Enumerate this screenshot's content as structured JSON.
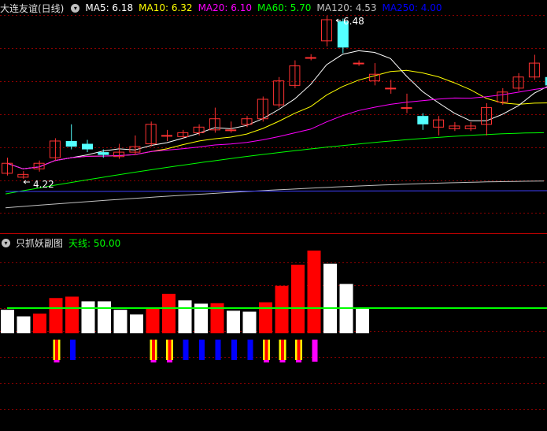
{
  "main_panel": {
    "stock_name": "大连友谊(日线)",
    "ma": [
      {
        "label": "MA5: 6.18",
        "color": "#ffffff"
      },
      {
        "label": "MA10: 6.32",
        "color": "#ffff00"
      },
      {
        "label": "MA20: 6.10",
        "color": "#ff00ff"
      },
      {
        "label": "MA60: 5.70",
        "color": "#00ff00"
      },
      {
        "label": "MA120: 4.53",
        "color": "#c0c0c0"
      },
      {
        "label": "MA250: 4.00",
        "color": "#0000ff"
      }
    ],
    "high_label": "6.48",
    "low_label": "4.22"
  },
  "sub_panel": {
    "indicator_name": "只抓妖副图",
    "line_label": "天线: 50.00"
  },
  "colors": {
    "up": "#ff3232",
    "down": "#54ffff",
    "grid": "#8b0000",
    "bar_red": "#ff0000",
    "bar_white": "#ffffff",
    "signal_blue": "#0000ff",
    "signal_magenta": "#ff00ff",
    "signal_yellow": "#ffff00",
    "sky_line": "#00ff00"
  },
  "chart_data": {
    "type": "candlestick",
    "candles": [
      {
        "o": 4.32,
        "c": 4.5,
        "h": 4.6,
        "l": 4.28
      },
      {
        "o": 4.25,
        "c": 4.3,
        "h": 4.36,
        "l": 4.22
      },
      {
        "o": 4.4,
        "c": 4.5,
        "h": 4.55,
        "l": 4.35
      },
      {
        "o": 4.6,
        "c": 4.9,
        "h": 4.95,
        "l": 4.55
      },
      {
        "o": 4.9,
        "c": 4.8,
        "h": 5.2,
        "l": 4.75
      },
      {
        "o": 4.85,
        "c": 4.75,
        "h": 4.92,
        "l": 4.7
      },
      {
        "o": 4.7,
        "c": 4.65,
        "h": 4.75,
        "l": 4.6
      },
      {
        "o": 4.62,
        "c": 4.7,
        "h": 4.85,
        "l": 4.58
      },
      {
        "o": 4.7,
        "c": 4.8,
        "h": 5.0,
        "l": 4.65
      },
      {
        "o": 4.85,
        "c": 5.2,
        "h": 5.25,
        "l": 4.8
      },
      {
        "o": 5.0,
        "c": 5.0,
        "h": 5.1,
        "l": 4.9
      },
      {
        "o": 4.98,
        "c": 5.05,
        "h": 5.1,
        "l": 4.95
      },
      {
        "o": 5.05,
        "c": 5.15,
        "h": 5.2,
        "l": 5.0
      },
      {
        "o": 5.1,
        "c": 5.3,
        "h": 5.5,
        "l": 5.05
      },
      {
        "o": 5.1,
        "c": 5.1,
        "h": 5.25,
        "l": 5.05
      },
      {
        "o": 5.2,
        "c": 5.3,
        "h": 5.35,
        "l": 5.15
      },
      {
        "o": 5.3,
        "c": 5.65,
        "h": 5.7,
        "l": 5.25
      },
      {
        "o": 5.55,
        "c": 5.98,
        "h": 6.05,
        "l": 5.5
      },
      {
        "o": 5.9,
        "c": 6.25,
        "h": 6.35,
        "l": 5.85
      },
      {
        "o": 6.4,
        "c": 6.4,
        "h": 6.46,
        "l": 6.35
      },
      {
        "o": 6.7,
        "c": 7.08,
        "h": 7.15,
        "l": 6.6
      },
      {
        "o": 7.05,
        "c": 6.58,
        "h": 7.1,
        "l": 6.48
      },
      {
        "o": 6.3,
        "c": 6.3,
        "h": 6.35,
        "l": 6.25
      },
      {
        "o": 5.98,
        "c": 6.1,
        "h": 6.3,
        "l": 5.9
      },
      {
        "o": 5.85,
        "c": 5.85,
        "h": 6.0,
        "l": 5.75
      },
      {
        "o": 5.5,
        "c": 5.5,
        "h": 5.75,
        "l": 5.4
      },
      {
        "o": 5.35,
        "c": 5.2,
        "h": 5.4,
        "l": 5.1
      },
      {
        "o": 5.15,
        "c": 5.28,
        "h": 5.35,
        "l": 5.0
      },
      {
        "o": 5.12,
        "c": 5.17,
        "h": 5.24,
        "l": 5.08
      },
      {
        "o": 5.12,
        "c": 5.17,
        "h": 5.24,
        "l": 5.08
      },
      {
        "o": 5.2,
        "c": 5.5,
        "h": 5.58,
        "l": 5.0
      },
      {
        "o": 5.6,
        "c": 5.78,
        "h": 5.85,
        "l": 5.55
      },
      {
        "o": 5.85,
        "c": 6.05,
        "h": 6.12,
        "l": 5.8
      },
      {
        "o": 6.05,
        "c": 6.3,
        "h": 6.45,
        "l": 6.0
      },
      {
        "o": 6.05,
        "c": 5.9,
        "h": 6.3,
        "l": 5.82
      }
    ],
    "sub_bars": [
      {
        "v": 50,
        "c": "w"
      },
      {
        "v": 36,
        "c": "w"
      },
      {
        "v": 42,
        "c": "r"
      },
      {
        "v": 75,
        "c": "r"
      },
      {
        "v": 78,
        "c": "r"
      },
      {
        "v": 68,
        "c": "w"
      },
      {
        "v": 68,
        "c": "w"
      },
      {
        "v": 50,
        "c": "w"
      },
      {
        "v": 40,
        "c": "w"
      },
      {
        "v": 55,
        "c": "r"
      },
      {
        "v": 84,
        "c": "r"
      },
      {
        "v": 70,
        "c": "w"
      },
      {
        "v": 63,
        "c": "w"
      },
      {
        "v": 64,
        "c": "r"
      },
      {
        "v": 48,
        "c": "w"
      },
      {
        "v": 46,
        "c": "w"
      },
      {
        "v": 66,
        "c": "r"
      },
      {
        "v": 101,
        "c": "r"
      },
      {
        "v": 146,
        "c": "r"
      },
      {
        "v": 176,
        "c": "r"
      },
      {
        "v": 148,
        "c": "w"
      },
      {
        "v": 105,
        "c": "w"
      },
      {
        "v": 53,
        "c": "w"
      }
    ],
    "signals": [
      {
        "i": 3,
        "t": "y"
      },
      {
        "i": 4,
        "t": "b"
      },
      {
        "i": 9,
        "t": "y"
      },
      {
        "i": 10,
        "t": "y"
      },
      {
        "i": 11,
        "t": "b"
      },
      {
        "i": 12,
        "t": "b"
      },
      {
        "i": 13,
        "t": "b"
      },
      {
        "i": 14,
        "t": "b"
      },
      {
        "i": 15,
        "t": "b"
      },
      {
        "i": 16,
        "t": "y"
      },
      {
        "i": 17,
        "t": "y"
      },
      {
        "i": 18,
        "t": "y"
      },
      {
        "i": 19,
        "t": "m"
      }
    ],
    "sky_line_value": 50
  }
}
